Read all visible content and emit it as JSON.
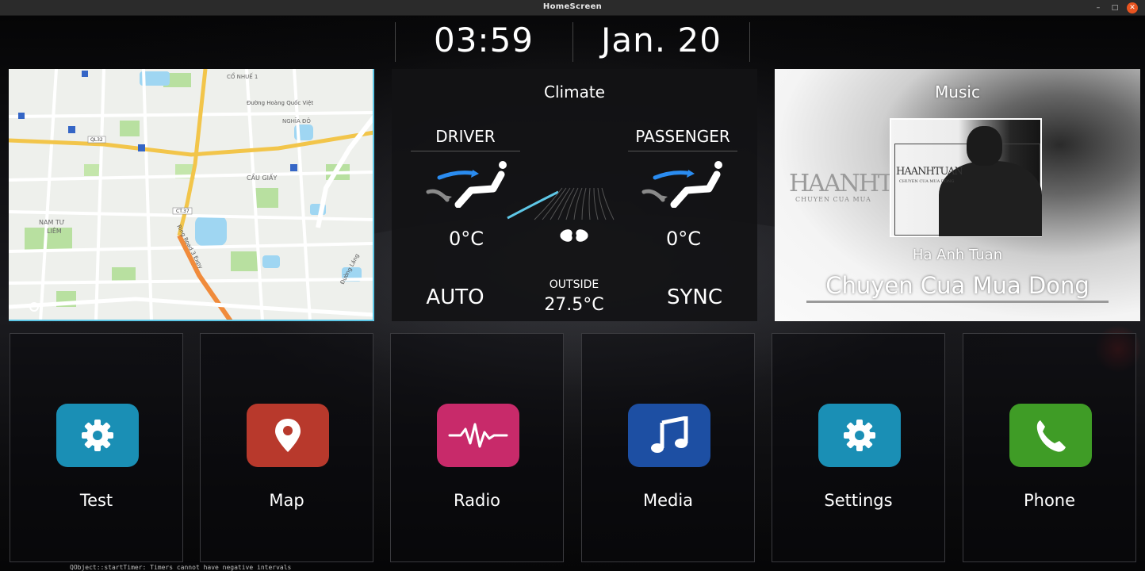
{
  "window": {
    "title": "HomeScreen",
    "min_glyph": "–",
    "max_glyph": "□",
    "close_glyph": "✕"
  },
  "status": {
    "time": "03:59",
    "date": "Jan. 20"
  },
  "map": {
    "labels": {
      "co_nhue": "CỔ NHUẾ 1",
      "hoang_quoc_viet": "Đường Hoàng Quốc Việt",
      "nghia_do": "NGHĨA ĐÔ",
      "cau_giay": "CẦU GIẤY",
      "nam_tu_liem_1": "NAM TƯ",
      "nam_tu_liem_2": "LIÊM",
      "ql32": "QL32",
      "ct37": "CT.37",
      "ring_road": "Ring Road 3 Expy",
      "duong_lang": "Đường Láng"
    }
  },
  "climate": {
    "title": "Climate",
    "driver_label": "DRIVER",
    "passenger_label": "PASSENGER",
    "driver_temp": "0°C",
    "passenger_temp": "0°C",
    "left_mode": "AUTO",
    "right_mode": "SYNC",
    "outside_label": "OUTSIDE",
    "outside_temp": "27.5°C",
    "fan_icon": "fan-icon"
  },
  "music": {
    "title": "Music",
    "album_art_text": "HAANHTUAN",
    "album_art_subtext": "CHUYEN CUA MUA DONG",
    "bg_text": "HAANHT",
    "bg_subtext": "CHUYEN CUA MUA",
    "artist": "Ha Anh Tuan",
    "song": "Chuyen Cua Mua Dong"
  },
  "apps": [
    {
      "label": "Test",
      "color": "#1a8fb5",
      "icon": "gear-icon"
    },
    {
      "label": "Map",
      "color": "#b8392c",
      "icon": "map-pin-icon"
    },
    {
      "label": "Radio",
      "color": "#c82a6a",
      "icon": "waveform-icon"
    },
    {
      "label": "Media",
      "color": "#1d4fa3",
      "icon": "music-note-icon"
    },
    {
      "label": "Settings",
      "color": "#1a8fb5",
      "icon": "gear-icon"
    },
    {
      "label": "Phone",
      "color": "#3f9c26",
      "icon": "phone-icon"
    }
  ],
  "console": {
    "text": "QObject::startTimer: Timers cannot have negative intervals"
  }
}
